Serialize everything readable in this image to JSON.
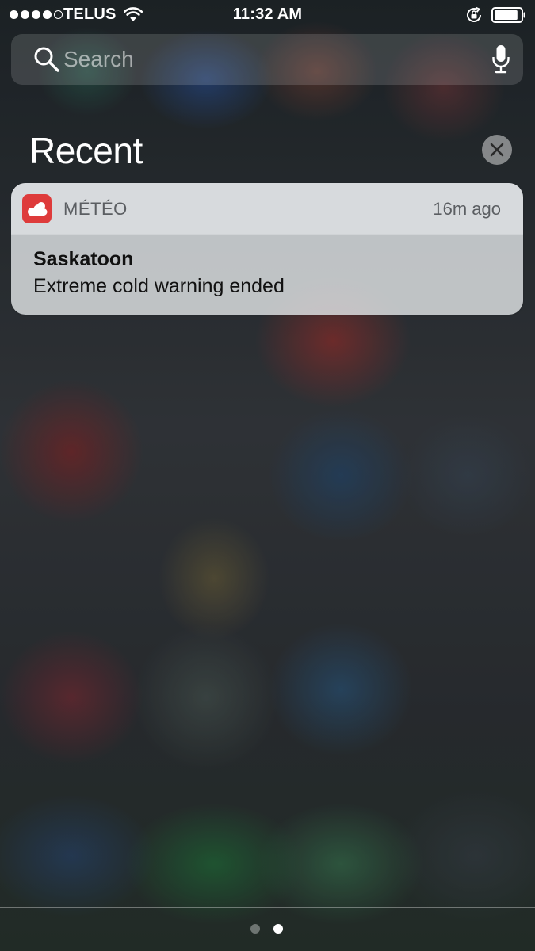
{
  "status_bar": {
    "signal_bars_filled": 4,
    "signal_bars_total": 5,
    "carrier": "TELUS",
    "time": "11:32 AM",
    "battery_level": 0.9,
    "icons": [
      "wifi-icon",
      "rotation-lock-icon",
      "battery-icon"
    ]
  },
  "search": {
    "placeholder": "Search",
    "value": "",
    "icon": "search-icon",
    "mic_icon": "microphone-icon"
  },
  "recent": {
    "title": "Recent",
    "clear_icon": "close-icon"
  },
  "notifications": [
    {
      "app_name": "MÉTÉO",
      "app_icon": "weather-cloud-icon",
      "app_color": "#de3b3b",
      "time": "16m ago",
      "title": "Saskatoon",
      "body": "Extreme cold warning ended"
    }
  ],
  "page_indicator": {
    "pages": 2,
    "current": 2
  }
}
